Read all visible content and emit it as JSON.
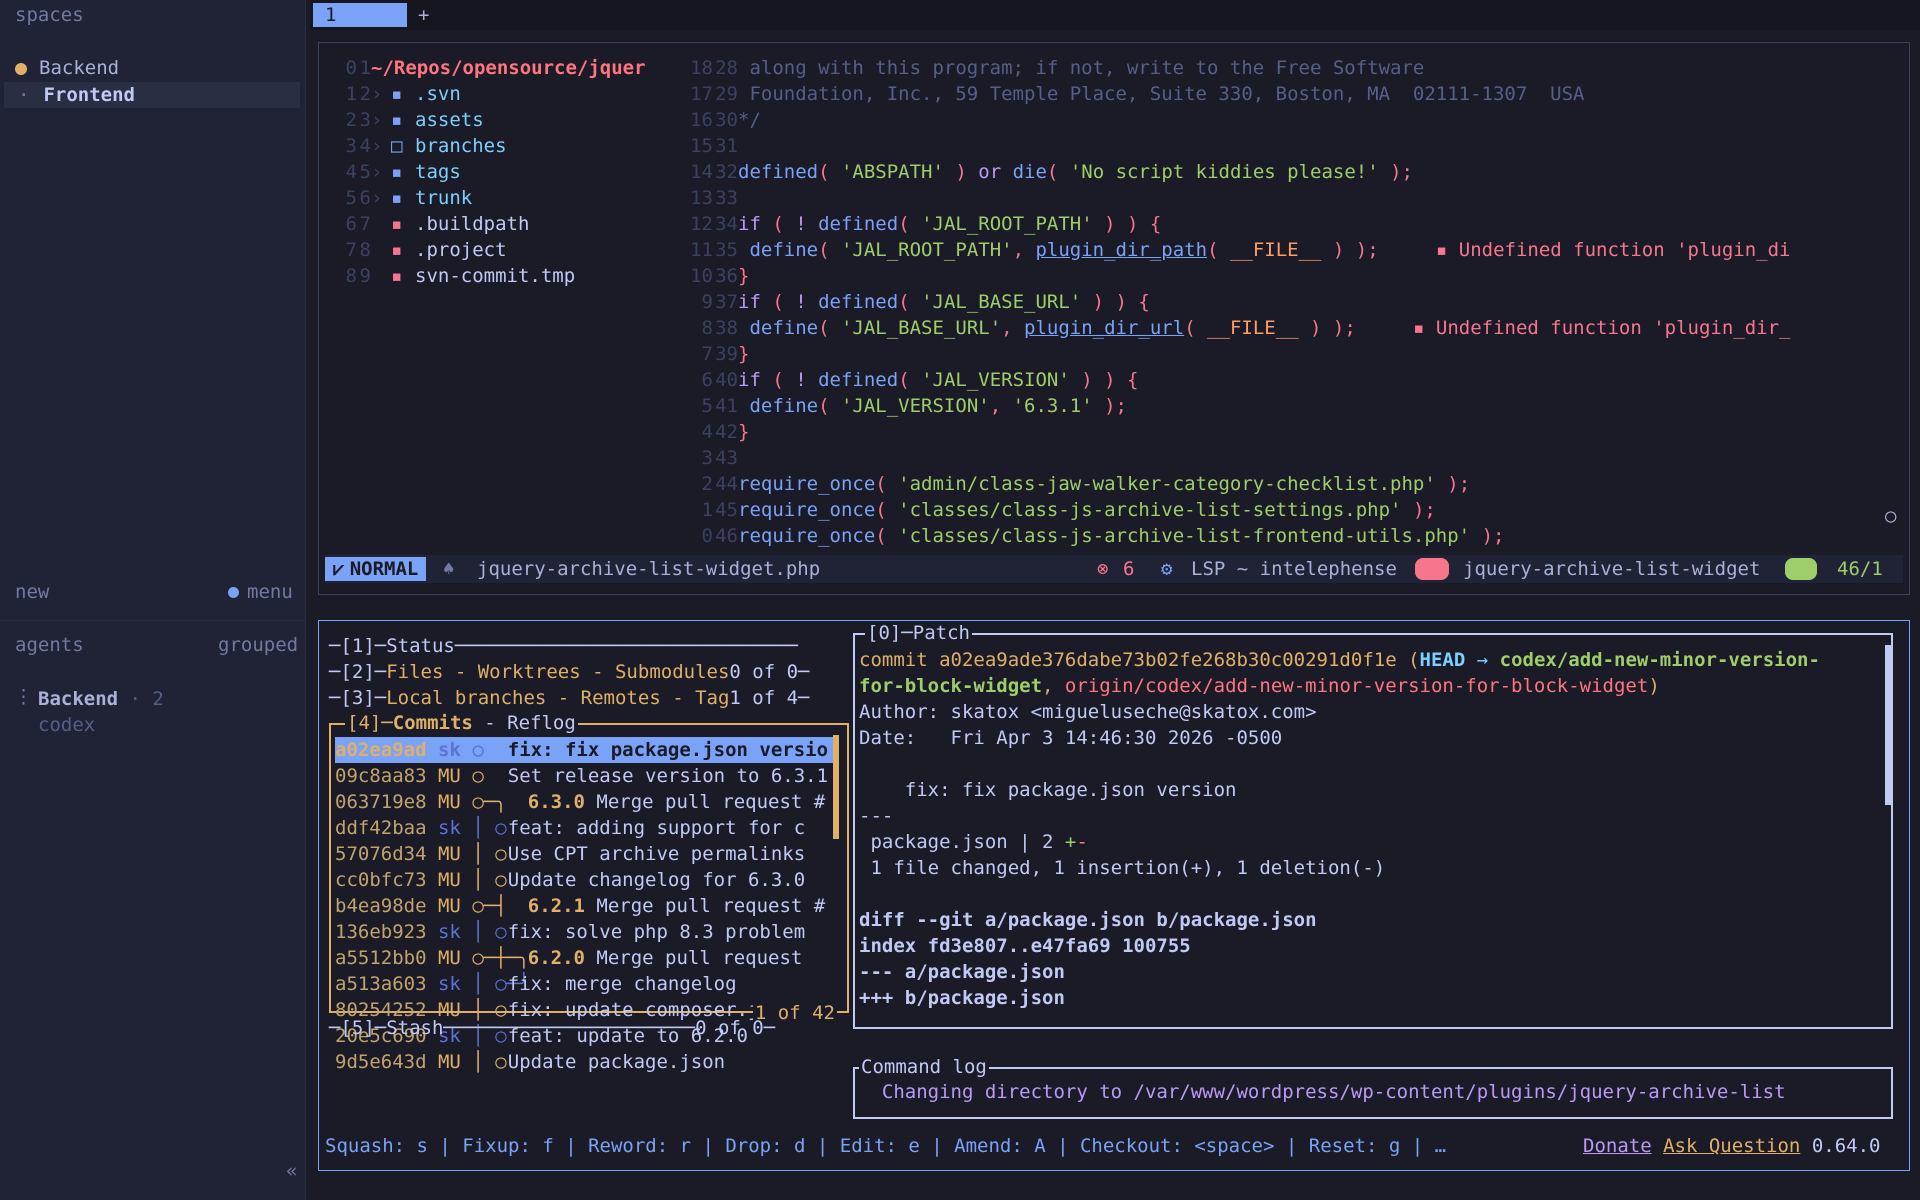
{
  "sidebar": {
    "spaces_title": "spaces",
    "spaces": [
      {
        "label": "Backend",
        "color": "#e0af68",
        "marker": "dot"
      },
      {
        "label": "Frontend",
        "marker": "bullet"
      }
    ],
    "new_label": "new",
    "menu_label": "menu",
    "agents_title": "agents",
    "grouped_label": "grouped",
    "agent_name": "Backend",
    "agent_count": "· 2",
    "agent_sub": "codex",
    "collapse_glyph": "«"
  },
  "tabs": {
    "active": "1",
    "add": "+"
  },
  "editor": {
    "tree": [
      {
        "rel": "0",
        "abs": "1",
        "name": "~/Repos/opensource/jquer",
        "kind": "root"
      },
      {
        "rel": "1",
        "abs": "2",
        "name": ".svn",
        "kind": "folder"
      },
      {
        "rel": "2",
        "abs": "3",
        "name": "assets",
        "kind": "folder"
      },
      {
        "rel": "3",
        "abs": "4",
        "name": "branches",
        "kind": "folder-open"
      },
      {
        "rel": "4",
        "abs": "5",
        "name": "tags",
        "kind": "folder"
      },
      {
        "rel": "5",
        "abs": "6",
        "name": "trunk",
        "kind": "folder"
      },
      {
        "rel": "6",
        "abs": "7",
        "name": ".buildpath",
        "kind": "file"
      },
      {
        "rel": "7",
        "abs": "8",
        "name": ".project",
        "kind": "file"
      },
      {
        "rel": "8",
        "abs": "9",
        "name": "svn-commit.tmp",
        "kind": "file"
      }
    ],
    "code_rel": [
      "18",
      "17",
      "16",
      "15",
      "14",
      "13",
      "12",
      "11",
      "10",
      "9",
      "8",
      "7",
      "6",
      "5",
      "4",
      "3",
      "2",
      "1",
      "0"
    ],
    "code_abs": [
      "28",
      "29",
      "30",
      "31",
      "32",
      "33",
      "34",
      "35",
      "36",
      "37",
      "38",
      "39",
      "40",
      "41",
      "42",
      "43",
      "44",
      "45",
      "46"
    ],
    "code": {
      "l28": " along with this program; if not, write to the Free Software",
      "l29": " Foundation, Inc., 59 Temple Place, Suite 330, Boston, MA  02111-1307  USA",
      "l30": "*/",
      "l32_fn": "defined",
      "l32_str": "'ABSPATH'",
      "l32_or": "or",
      "l32_die": "die",
      "l32_msg": "'No script kiddies please!'",
      "c_if": "if",
      "c_defined": "defined",
      "c_define": "define",
      "c_root": "'JAL_ROOT_PATH'",
      "c_base": "'JAL_BASE_URL'",
      "c_ver": "'JAL_VERSION'",
      "c_ver_val": "'6.3.1'",
      "c_plugin_path": "plugin_dir_path",
      "c_plugin_url": "plugin_dir_url",
      "c_file": "__FILE__",
      "c_req": "require_once",
      "req1": "'admin/class-jaw-walker-category-checklist.php'",
      "req2": "'classes/class-js-archive-list-settings.php'",
      "req3": "'classes/class-js-archive-list-frontend-utils.php'",
      "diag1": "▪ Undefined function 'plugin_di",
      "diag2": "▪ Undefined function 'plugin_dir_"
    },
    "status": {
      "mode": "NORMAL",
      "file": "jquery-archive-list-widget.php",
      "errors": "6",
      "lsp": "LSP ~ intelephense",
      "project": "jquery-archive-list-widget",
      "position": "46/1"
    }
  },
  "git": {
    "panels": {
      "status": "[1]─Status",
      "files": "[2]─",
      "files_tabs": "Files - Worktrees - Submodules",
      "files_count": "0 of 0",
      "branches": "[3]─",
      "branches_tabs": "Local branches - Remotes - Tag",
      "branches_count": "1 of 4",
      "commits": "[4]─",
      "commits_tabs": "Commits",
      "commits_reflog": " - Reflog",
      "commits_count": "1 of 42",
      "stash": "[5]─Stash",
      "stash_count": "0 of 0",
      "patch": "[0]─Patch",
      "cmdlog": "Command log"
    },
    "commits": [
      {
        "hash": "a02ea9ad",
        "author": "sk",
        "graph": "○",
        "msg": "fix: fix package.json versio"
      },
      {
        "hash": "09c8aa83",
        "author": "MU",
        "graph": "○",
        "msg": "Set release version to 6.3.1"
      },
      {
        "hash": "063719e8",
        "author": "MU",
        "graph": "○─╮",
        "tag": "6.3.0",
        "msg": "Merge pull request #"
      },
      {
        "hash": "ddf42baa",
        "author": "sk",
        "graph": "│ ○",
        "msg": "feat: adding support for c"
      },
      {
        "hash": "57076d34",
        "author": "MU",
        "graph": "│ ○",
        "msg": "Use CPT archive permalinks"
      },
      {
        "hash": "cc0bfc73",
        "author": "MU",
        "graph": "│ ○",
        "msg": "Update changelog for 6.3.0"
      },
      {
        "hash": "b4ea98de",
        "author": "MU",
        "graph": "○─┤",
        "tag": "6.2.1",
        "msg": "Merge pull request #"
      },
      {
        "hash": "136eb923",
        "author": "sk",
        "graph": "│ ○",
        "msg": "fix: solve php 8.3 problem"
      },
      {
        "hash": "a5512bb0",
        "author": "MU",
        "graph": "○─┼─╮",
        "tag": "6.2.0",
        "msg": "Merge pull request"
      },
      {
        "hash": "a513a603",
        "author": "sk",
        "graph": "│ ○─╯",
        "msg": "fix: merge changelog"
      },
      {
        "hash": "80254252",
        "author": "MU",
        "graph": "│ ○",
        "msg": "fix: update composer.json"
      },
      {
        "hash": "20e5c690",
        "author": "sk",
        "graph": "│ ○",
        "msg": "feat: update to 6.2.0"
      },
      {
        "hash": "9d5e643d",
        "author": "MU",
        "graph": "│ ○",
        "msg": "Update package.json"
      }
    ],
    "patch": {
      "commit_label": "commit a02ea9ade376dabe73b02fe268b30c00291d0f1e",
      "head": "HEAD",
      "arrow": " → ",
      "branch": "codex/add-new-minor-version-",
      "branch2": "for-block-widget",
      "origin": "origin/codex/add-new-minor-version-for-block-widget",
      "author": "Author: skatox <migueluseche@skatox.com>",
      "date": "Date:   Fri Apr 3 14:46:30 2026 -0500",
      "subject": "    fix: fix package.json version",
      "sep": "---",
      "stat_file": " package.json | 2 ",
      "stat_plus": "+",
      "stat_minus": "-",
      "summary": " 1 file changed, 1 insertion(+), 1 deletion(-)",
      "diff1": "diff --git a/package.json b/package.json",
      "diff2": "index fd3e807..e47fa69 100755",
      "diff3": "--- a/package.json",
      "diff4": "+++ b/package.json"
    },
    "cmdlog_text": "  Changing directory to /var/www/wordpress/wp-content/plugins/jquery-archive-list",
    "keybinds": "Squash: s | Fixup: f | Reword: r | Drop: d | Edit: e | Amend: A | Checkout: <space> | Reset: g | …",
    "donate": "Donate",
    "ask": "Ask Question",
    "version": "0.64.0"
  },
  "colors": {
    "bg": "#1a1b26",
    "accent": "#7aa2f7",
    "error": "#f7768e",
    "string": "#9ece6a",
    "hash": "#e0af68"
  }
}
